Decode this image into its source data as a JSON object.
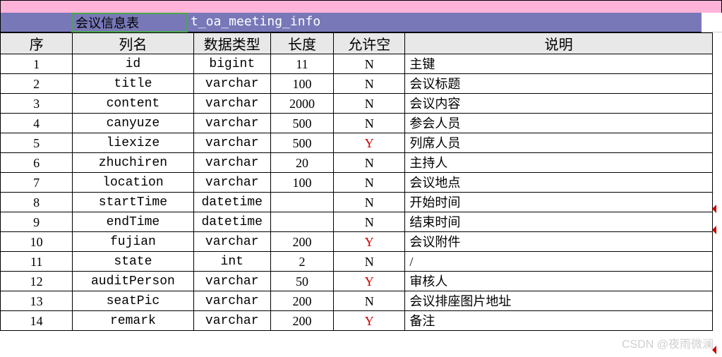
{
  "title_label": "会议信息表",
  "table_code": "t_oa_meeting_info",
  "headers": {
    "seq": "序",
    "name": "列名",
    "type": "数据类型",
    "len": "长度",
    "nullable": "允许空",
    "desc": "说明"
  },
  "rows": [
    {
      "seq": "1",
      "name": "id",
      "type": "bigint",
      "len": "11",
      "nullable": "N",
      "desc": "主键"
    },
    {
      "seq": "2",
      "name": "title",
      "type": "varchar",
      "len": "100",
      "nullable": "N",
      "desc": "会议标题"
    },
    {
      "seq": "3",
      "name": "content",
      "type": "varchar",
      "len": "2000",
      "nullable": "N",
      "desc": "会议内容"
    },
    {
      "seq": "4",
      "name": "canyuze",
      "type": "varchar",
      "len": "500",
      "nullable": "N",
      "desc": "参会人员"
    },
    {
      "seq": "5",
      "name": "liexize",
      "type": "varchar",
      "len": "500",
      "nullable": "Y",
      "desc": "列席人员"
    },
    {
      "seq": "6",
      "name": "zhuchiren",
      "type": "varchar",
      "len": "20",
      "nullable": "N",
      "desc": "主持人"
    },
    {
      "seq": "7",
      "name": "location",
      "type": "varchar",
      "len": "100",
      "nullable": "N",
      "desc": "会议地点"
    },
    {
      "seq": "8",
      "name": "startTime",
      "type": "datetime",
      "len": "",
      "nullable": "N",
      "desc": "开始时间"
    },
    {
      "seq": "9",
      "name": "endTime",
      "type": "datetime",
      "len": "",
      "nullable": "N",
      "desc": "结束时间"
    },
    {
      "seq": "10",
      "name": "fujian",
      "type": "varchar",
      "len": "200",
      "nullable": "Y",
      "desc": "会议附件"
    },
    {
      "seq": "11",
      "name": "state",
      "type": "int",
      "len": "2",
      "nullable": "N",
      "desc": "/"
    },
    {
      "seq": "12",
      "name": "auditPerson",
      "type": "varchar",
      "len": "50",
      "nullable": "Y",
      "desc": "审核人"
    },
    {
      "seq": "13",
      "name": "seatPic",
      "type": "varchar",
      "len": "200",
      "nullable": "N",
      "desc": "会议排座图片地址"
    },
    {
      "seq": "14",
      "name": "remark",
      "type": "varchar",
      "len": "200",
      "nullable": "Y",
      "desc": "备注"
    }
  ],
  "watermark": "CSDN @夜雨微澜"
}
